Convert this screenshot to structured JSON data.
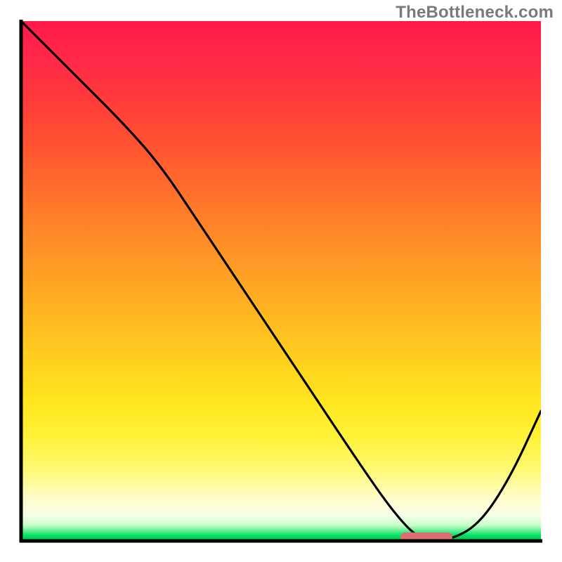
{
  "watermark": "TheBottleneck.com",
  "colors": {
    "grad_top": "#ff1a4b",
    "grad_bottom": "#00c050",
    "curve": "#000000",
    "axis": "#000000",
    "marker": "#d9706f",
    "watermark_text": "#7a7a7a"
  },
  "chart_data": {
    "type": "line",
    "title": "",
    "xlabel": "",
    "ylabel": "",
    "xlim": [
      0,
      100
    ],
    "ylim": [
      0,
      100
    ],
    "grid": false,
    "legend": false,
    "series": [
      {
        "name": "bottleneck-curve",
        "x": [
          0,
          10,
          20,
          27,
          35,
          45,
          55,
          65,
          72,
          77,
          82,
          88,
          94,
          100
        ],
        "y": [
          100,
          90,
          80,
          72,
          60,
          45,
          30,
          15,
          5,
          0,
          0,
          3,
          12,
          25
        ]
      }
    ],
    "annotations": [
      {
        "name": "optimal-range-marker",
        "type": "bar-segment",
        "x_start": 73,
        "x_end": 83,
        "y": 0
      }
    ]
  }
}
